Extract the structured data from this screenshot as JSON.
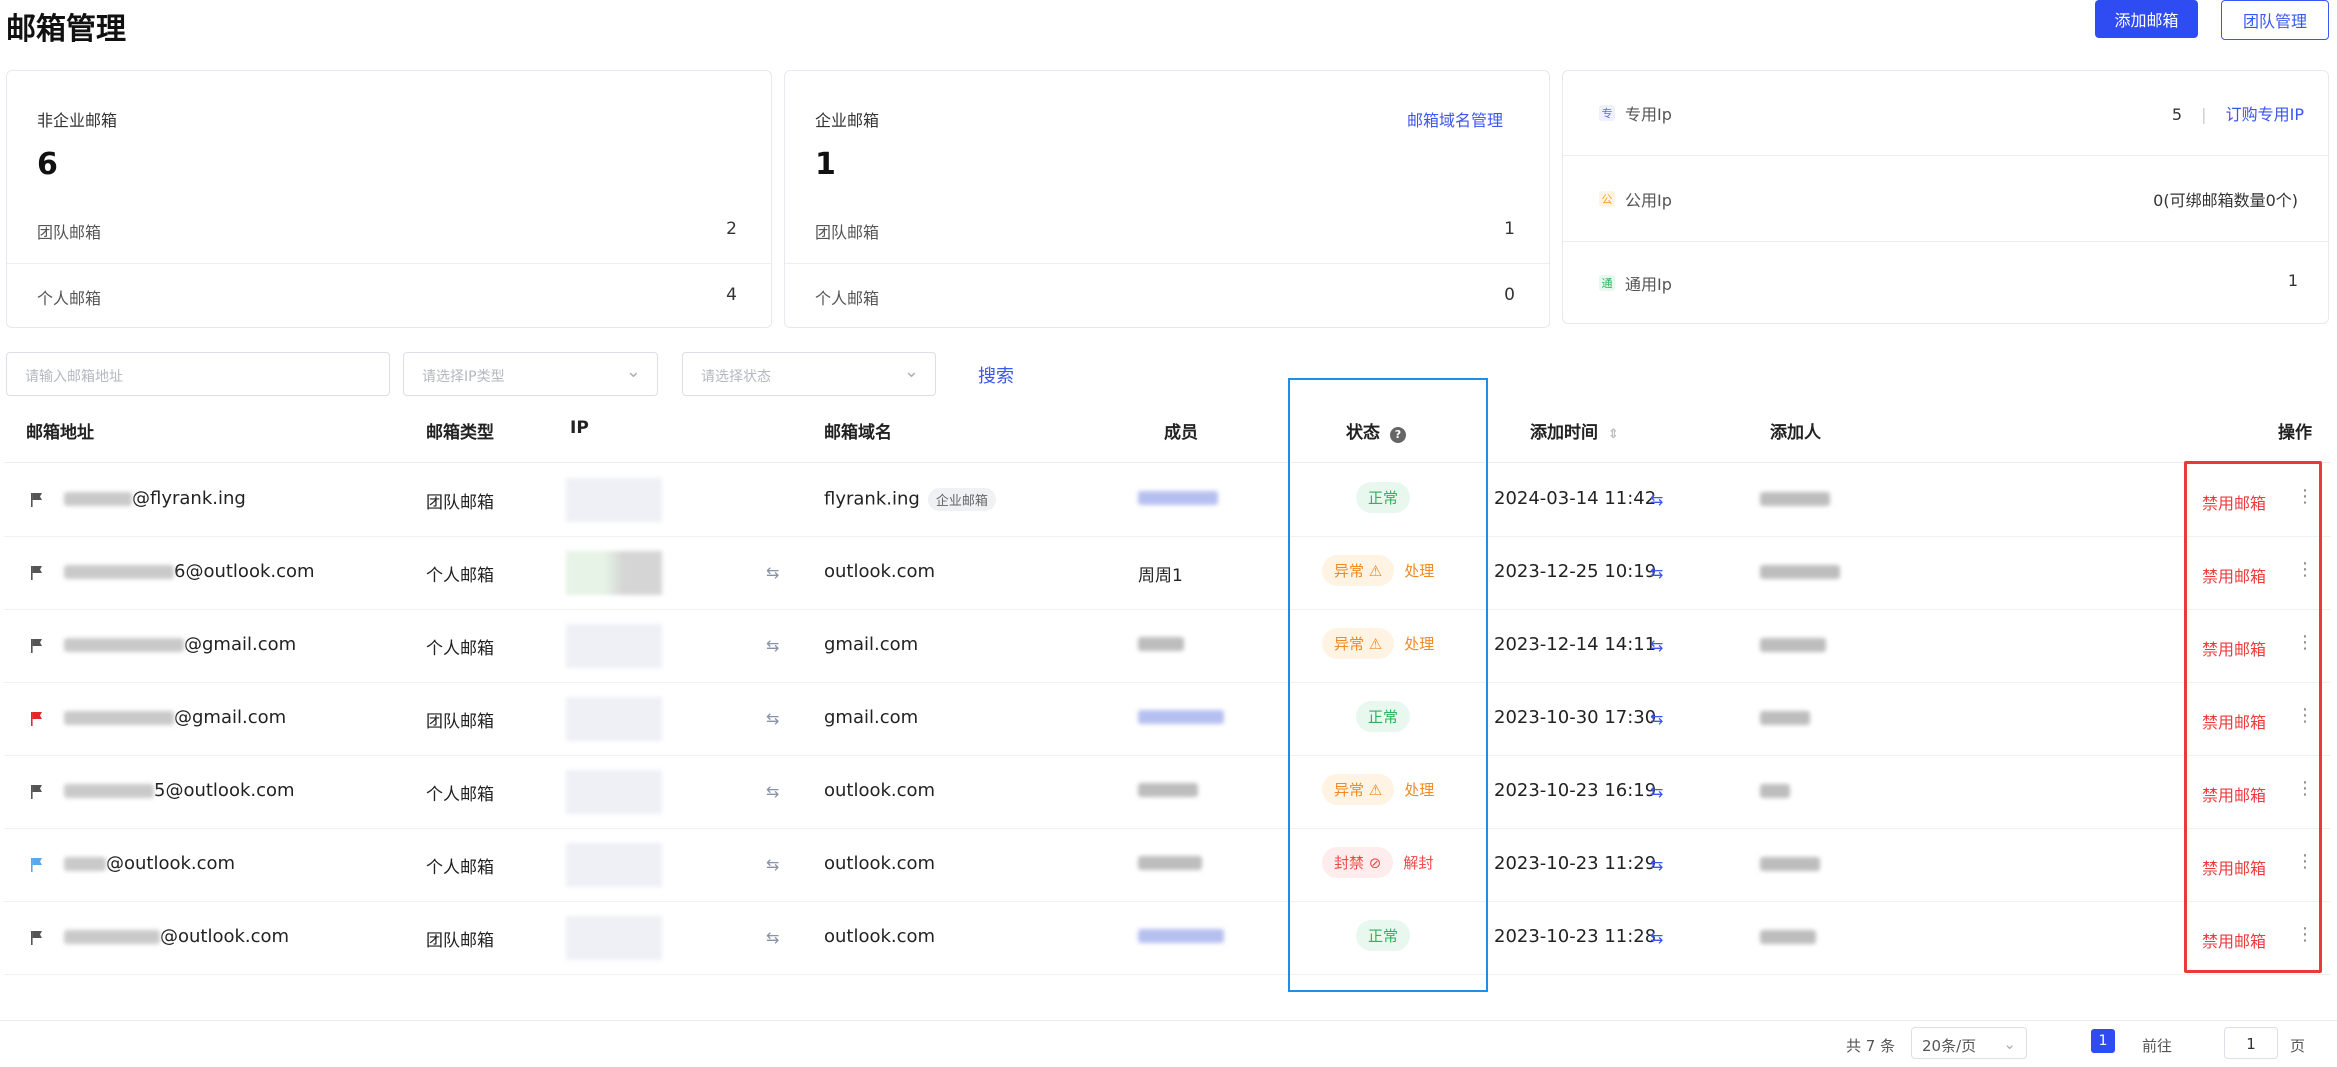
{
  "header": {
    "title": "邮箱管理",
    "add_label": "添加邮箱",
    "team_label": "团队管理"
  },
  "cards": {
    "non_enterprise": {
      "title": "非企业邮箱",
      "count": "6",
      "rows": [
        {
          "name": "团队邮箱",
          "value": "2"
        },
        {
          "name": "个人邮箱",
          "value": "4"
        }
      ]
    },
    "enterprise": {
      "title": "企业邮箱",
      "count": "1",
      "link": "邮箱域名管理",
      "rows": [
        {
          "name": "团队邮箱",
          "value": "1"
        },
        {
          "name": "个人邮箱",
          "value": "0"
        }
      ]
    },
    "ip": {
      "rows": [
        {
          "icon": "专",
          "name": "专用Ip",
          "value": "5",
          "link": "订购专用IP",
          "color": "#5b6cf0",
          "bg": "#eef0ff"
        },
        {
          "icon": "公",
          "name": "公用Ip",
          "value": "0(可绑邮箱数量0个)",
          "color": "#f0a52a",
          "bg": "#fff4e2"
        },
        {
          "icon": "通",
          "name": "通用Ip",
          "value": "1",
          "color": "#2bb45a",
          "bg": "#e9f8ee"
        }
      ]
    }
  },
  "filters": {
    "email_placeholder": "请输入邮箱地址",
    "ip_placeholder": "请选择IP类型",
    "status_placeholder": "请选择状态",
    "search_label": "搜索"
  },
  "table": {
    "columns": {
      "email": "邮箱地址",
      "type": "邮箱类型",
      "ip": "IP",
      "domain": "邮箱域名",
      "member": "成员",
      "status": "状态",
      "time": "添加时间",
      "creator": "添加人",
      "action": "操作"
    },
    "rows": [
      {
        "flag": "#555555",
        "email_tail": "@flyrank.ing",
        "type": "团队邮箱",
        "domain": "flyrank.ing",
        "domain_tag": "企业邮箱",
        "member": "",
        "status": "正常",
        "status_kind": "ok",
        "action": "",
        "time": "2024-03-14 11:42",
        "disable": "禁用邮箱"
      },
      {
        "flag": "#555555",
        "email_tail": "6@outlook.com",
        "type": "个人邮箱",
        "domain": "outlook.com",
        "domain_tag": "",
        "member": "周周1",
        "status": "异常 ⚠",
        "status_kind": "warn",
        "action": "处理",
        "time": "2023-12-25 10:19",
        "disable": "禁用邮箱"
      },
      {
        "flag": "#555555",
        "email_tail": "@gmail.com",
        "type": "个人邮箱",
        "domain": "gmail.com",
        "domain_tag": "",
        "member": "",
        "status": "异常 ⚠",
        "status_kind": "warn",
        "action": "处理",
        "time": "2023-12-14 14:11",
        "disable": "禁用邮箱"
      },
      {
        "flag": "#e02a2a",
        "email_tail": "@gmail.com",
        "type": "团队邮箱",
        "domain": "gmail.com",
        "domain_tag": "",
        "member": "",
        "status": "正常",
        "status_kind": "ok",
        "action": "",
        "time": "2023-10-30 17:30",
        "disable": "禁用邮箱"
      },
      {
        "flag": "#555555",
        "email_tail": "5@outlook.com",
        "type": "个人邮箱",
        "domain": "outlook.com",
        "domain_tag": "",
        "member": "",
        "status": "异常 ⚠",
        "status_kind": "warn",
        "action": "处理",
        "time": "2023-10-23 16:19",
        "disable": "禁用邮箱"
      },
      {
        "flag": "#5aa8e8",
        "email_tail": "@outlook.com",
        "type": "个人邮箱",
        "domain": "outlook.com",
        "domain_tag": "",
        "member": "",
        "status": "封禁 ⊘",
        "status_kind": "ban",
        "action": "解封",
        "time": "2023-10-23 11:29",
        "disable": "禁用邮箱"
      },
      {
        "flag": "#555555",
        "email_tail": "@outlook.com",
        "type": "团队邮箱",
        "domain": "outlook.com",
        "domain_tag": "",
        "member": "",
        "status": "正常",
        "status_kind": "ok",
        "action": "",
        "time": "2023-10-23 11:28",
        "disable": "禁用邮箱"
      }
    ]
  },
  "pagination": {
    "total": "共 7 条",
    "page_size": "20条/页",
    "current": "1",
    "goto_label": "前往",
    "goto_value": "1",
    "page_word": "页"
  }
}
